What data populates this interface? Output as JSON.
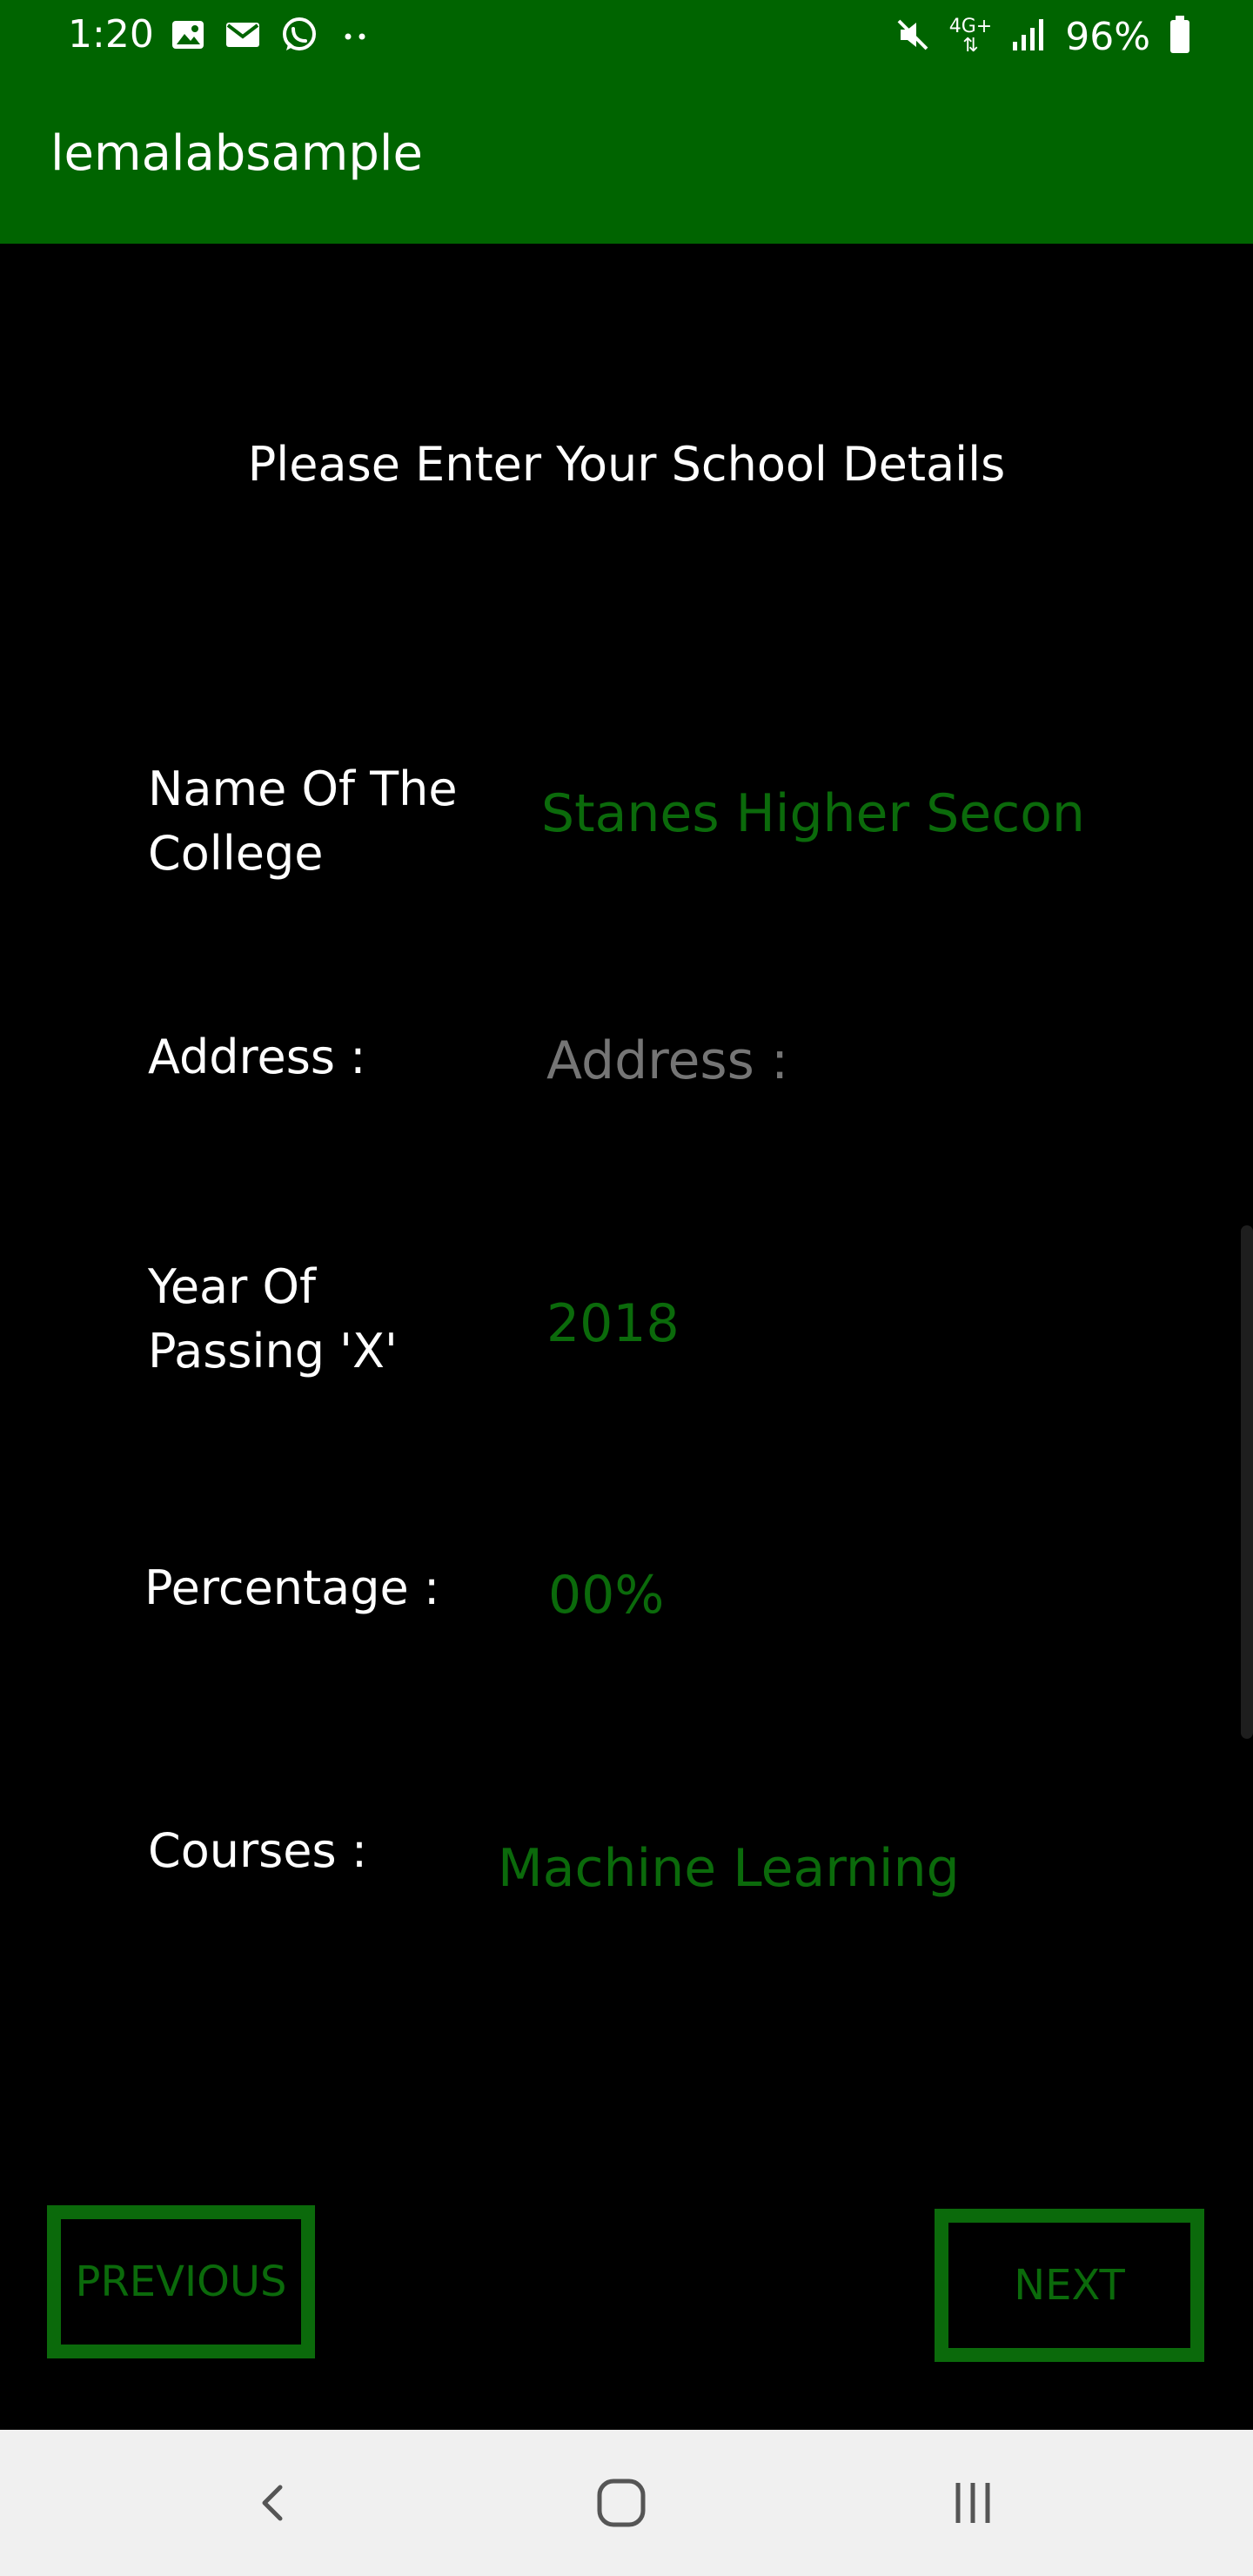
{
  "status_bar": {
    "time": "1:20",
    "battery_percent": "96%",
    "network_label": "4G+",
    "left_icons": [
      "image-icon",
      "mail-icon",
      "whatsapp-icon",
      "more-dots-icon"
    ],
    "right_icons": [
      "mute-icon",
      "network-icon",
      "signal-icon",
      "battery-icon"
    ]
  },
  "app_bar": {
    "title": "lemalabsample",
    "color": "#006400"
  },
  "form": {
    "heading": "Please Enter Your School Details",
    "fields": [
      {
        "label": "Name Of The College",
        "value": "Stanes Higher  Secon",
        "placeholder": ""
      },
      {
        "label": "Address :",
        "value": "",
        "placeholder": "Address :"
      },
      {
        "label": "Year Of Passing 'X'",
        "value": "2018",
        "placeholder": ""
      },
      {
        "label": "Percentage :",
        "value": "00%",
        "placeholder": ""
      },
      {
        "label": "Courses :",
        "value": "Machine Learning",
        "placeholder": ""
      }
    ],
    "text_color": "#0b6a0b"
  },
  "buttons": {
    "previous_label": "PREVIOUS",
    "next_label": "NEXT"
  },
  "nav_bar": {
    "icons": [
      "back-icon",
      "home-icon",
      "recent-apps-icon"
    ]
  }
}
